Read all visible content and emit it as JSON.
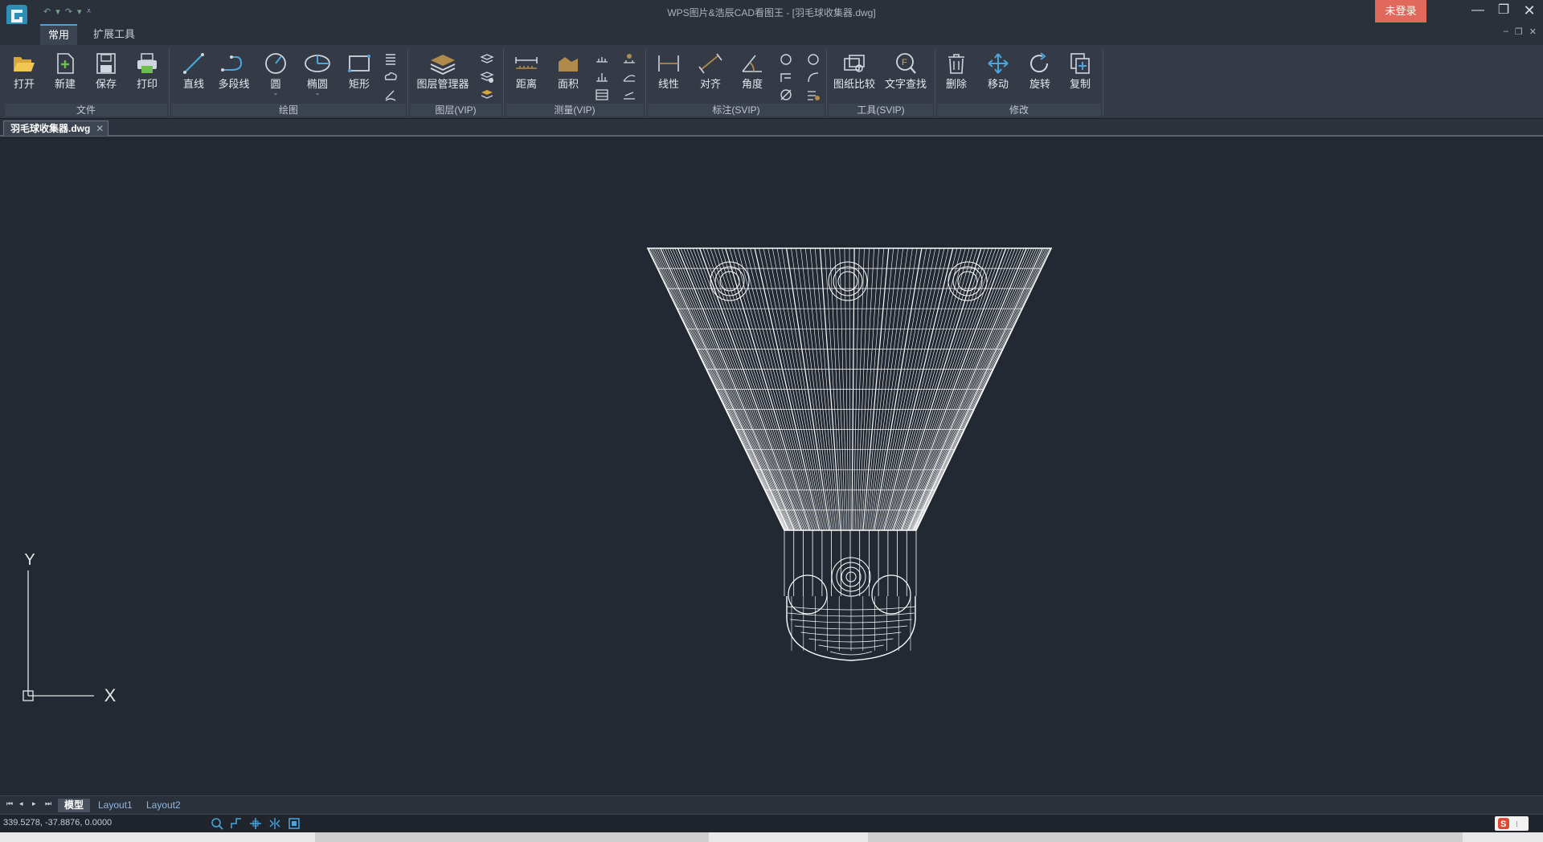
{
  "window": {
    "title": "WPS图片&浩辰CAD看图王 - [羽毛球收集器.dwg]",
    "login_label": "未登录",
    "accent": "#e0695c"
  },
  "ribbon_tabs": [
    "常用",
    "扩展工具"
  ],
  "groups": {
    "file": {
      "label": "文件",
      "buttons": [
        "打开",
        "新建",
        "保存",
        "打印"
      ]
    },
    "draw": {
      "label": "绘图",
      "buttons": [
        "直线",
        "多段线",
        "圆",
        "椭圆",
        "矩形"
      ]
    },
    "layer": {
      "label": "图层(VIP)",
      "buttons": [
        "图层管理器"
      ]
    },
    "measure": {
      "label": "测量(VIP)",
      "buttons": [
        "距离",
        "面积"
      ]
    },
    "dimension": {
      "label": "标注(SVIP)",
      "buttons": [
        "线性",
        "对齐",
        "角度"
      ]
    },
    "tools": {
      "label": "工具(SVIP)",
      "buttons": [
        "图纸比较",
        "文字查找"
      ]
    },
    "modify": {
      "label": "修改",
      "buttons": [
        "删除",
        "移动",
        "旋转",
        "复制"
      ]
    }
  },
  "document_tab": "羽毛球收集器.dwg",
  "layout_tabs": [
    "模型",
    "Layout1",
    "Layout2"
  ],
  "ucs": {
    "x_label": "X",
    "y_label": "Y"
  },
  "status": {
    "coords": "339.5278, -37.8876, 0.0000"
  }
}
